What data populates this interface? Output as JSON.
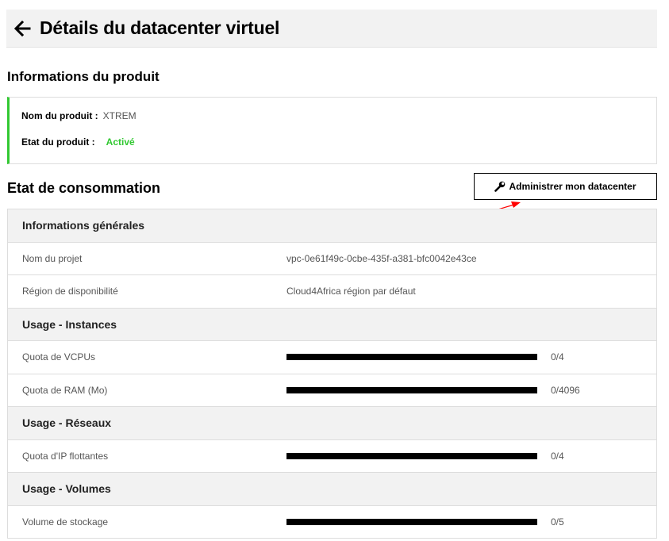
{
  "header": {
    "back_icon": "arrow-left-icon",
    "title": "Détails du datacenter virtuel"
  },
  "product_section": {
    "title": "Informations du produit",
    "name_label": "Nom du produit :",
    "name_value": "XTREM",
    "state_label": "Etat du produit :",
    "state_value": "Activé",
    "accent_color": "#32c832"
  },
  "consumption_section": {
    "title": "Etat de consommation",
    "admin_button": {
      "icon": "wrench-icon",
      "label": "Administrer mon datacenter"
    },
    "annotation_color": "#ff0000"
  },
  "table": {
    "general": {
      "header": "Informations générales",
      "rows": [
        {
          "label": "Nom du projet",
          "value": "vpc-0e61f49c-0cbe-435f-a381-bfc0042e43ce"
        },
        {
          "label": "Région de disponibilité",
          "value": "Cloud4Africa région par défaut"
        }
      ]
    },
    "instances": {
      "header": "Usage - Instances",
      "rows": [
        {
          "label": "Quota de VCPUs",
          "used": 0,
          "max": 4,
          "text": "0/4"
        },
        {
          "label": "Quota de RAM (Mo)",
          "used": 0,
          "max": 4096,
          "text": "0/4096"
        }
      ]
    },
    "networks": {
      "header": "Usage - Réseaux",
      "rows": [
        {
          "label": "Quota d'IP flottantes",
          "used": 0,
          "max": 4,
          "text": "0/4"
        }
      ]
    },
    "volumes": {
      "header": "Usage - Volumes",
      "rows": [
        {
          "label": "Volume de stockage",
          "used": 0,
          "max": 5,
          "text": "0/5"
        }
      ]
    }
  }
}
